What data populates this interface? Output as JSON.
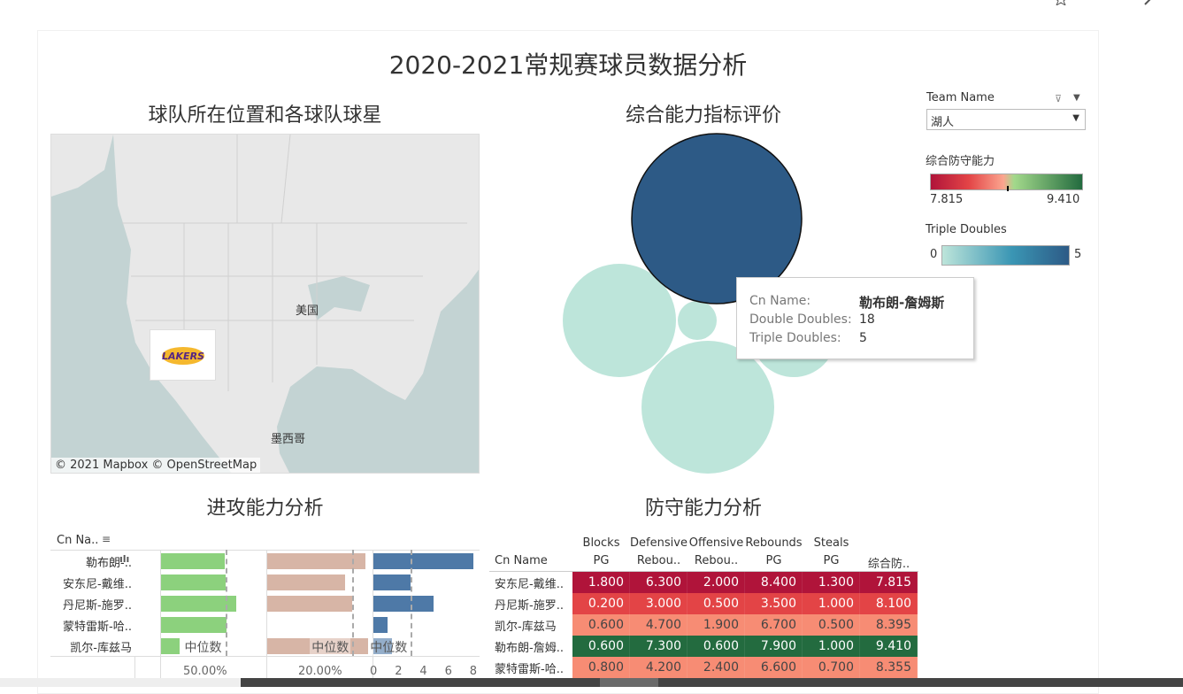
{
  "title": "2020-2021常规赛球员数据分析",
  "toolbar": {
    "icons": [
      "star-icon",
      "edit-icon"
    ]
  },
  "map": {
    "title": "球队所在位置和各球队球星",
    "labels": {
      "usa": "美国",
      "mexico": "墨西哥"
    },
    "credit": "© 2021 Mapbox  © OpenStreetMap",
    "logo": "LAKERS",
    "colors": {
      "water": "#c3d3d3",
      "land": "#e8e8e8"
    }
  },
  "bubble": {
    "title": "综合能力指标评价",
    "colors": {
      "low": "#bde5da",
      "high": "#2d5a86"
    },
    "tooltip": {
      "k1": "Cn Name:",
      "v1": "勒布朗-詹姆斯",
      "k2": "Double Doubles:",
      "v2": "18",
      "k3": "Triple Doubles:",
      "v3": "5"
    }
  },
  "filter": {
    "label": "Team Name",
    "value": "湖人"
  },
  "legend_def": {
    "title": "综合防守能力",
    "min": "7.815",
    "max": "9.410",
    "colors": [
      "#b0143a",
      "#e34446",
      "#fba58f",
      "#a3d98b",
      "#236b3f"
    ]
  },
  "legend_td": {
    "title": "Triple Doubles",
    "min": "0",
    "max": "5",
    "colors": [
      "#bde5da",
      "#3a96b4",
      "#2d5a86"
    ]
  },
  "offense": {
    "title": "进攻能力分析",
    "header": "Cn Na..",
    "median_label": "中位数",
    "names": [
      "勒布朗-..",
      "安东尼-戴维..",
      "丹尼斯-施罗..",
      "蒙特雷斯-哈..",
      "凯尔-库兹马"
    ],
    "axis1": "50.00%",
    "axis2": "20.00%",
    "axis3": [
      "0",
      "2",
      "4",
      "6",
      "8"
    ],
    "s1": {
      "values": [
        71.7,
        73.0,
        84.7,
        73.7,
        20.7
      ],
      "median": 72.5,
      "color": "#8cd17d"
    },
    "s2": {
      "values": [
        36.9,
        29.3,
        32.1,
        0,
        37.9
      ],
      "median": 32.1,
      "color": "#d7b5a6"
    },
    "s3": {
      "values": [
        8.0,
        3.0,
        4.8,
        1.1,
        1.5
      ],
      "median": 3.0,
      "color": "#4e79a7"
    }
  },
  "defense": {
    "title": "防守能力分析",
    "headers": [
      [
        "",
        "Cn Name"
      ],
      [
        "Blocks",
        "PG"
      ],
      [
        "Defensive",
        "Rebou.."
      ],
      [
        "Offensive",
        "Rebou.."
      ],
      [
        "Rebounds",
        "PG"
      ],
      [
        "Steals",
        "PG"
      ],
      [
        "",
        "综合防.."
      ]
    ],
    "rows": [
      {
        "name": "安东尼-戴维..",
        "vals": [
          "1.800",
          "6.300",
          "2.000",
          "8.400",
          "1.300",
          "7.815"
        ],
        "color": "#b0143a",
        "fg": "#fff"
      },
      {
        "name": "丹尼斯-施罗..",
        "vals": [
          "0.200",
          "3.000",
          "0.500",
          "3.500",
          "1.000",
          "8.100"
        ],
        "color": "#e34446",
        "fg": "#fff"
      },
      {
        "name": "凯尔-库兹马",
        "vals": [
          "0.600",
          "4.700",
          "1.900",
          "6.700",
          "0.500",
          "8.395"
        ],
        "color": "#f78c74",
        "fg": "#444"
      },
      {
        "name": "勒布朗-詹姆..",
        "vals": [
          "0.600",
          "7.300",
          "0.600",
          "7.900",
          "1.000",
          "9.410"
        ],
        "color": "#236b3f",
        "fg": "#fff"
      },
      {
        "name": "蒙特雷斯-哈..",
        "vals": [
          "0.800",
          "4.200",
          "2.400",
          "6.600",
          "0.700",
          "8.355"
        ],
        "color": "#f78c74",
        "fg": "#444"
      }
    ]
  }
}
